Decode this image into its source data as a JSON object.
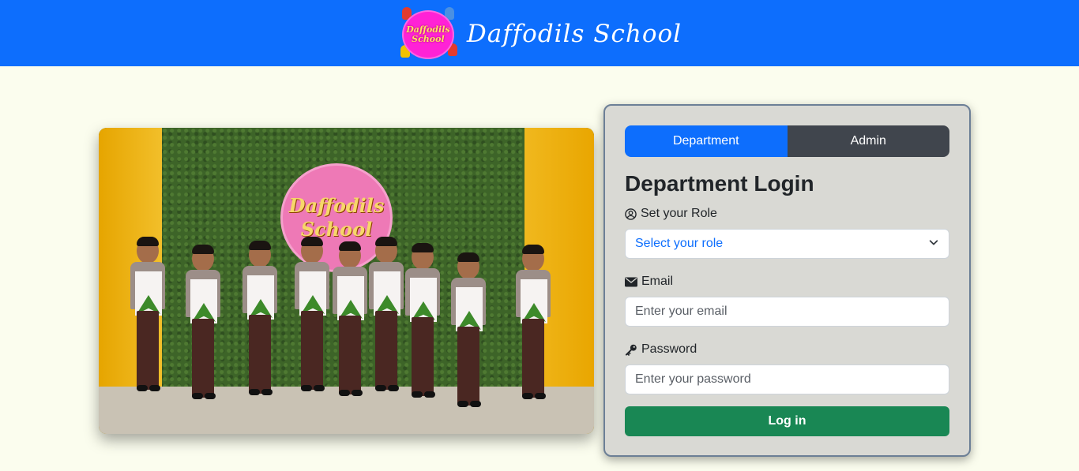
{
  "header": {
    "logo_text_line1": "Daffodils",
    "logo_text_line2": "School",
    "title": "Daffodils School",
    "background": "#0d6efd"
  },
  "photo": {
    "sign_line1": "Daffodils",
    "sign_line2": "School"
  },
  "login": {
    "tabs": [
      {
        "label": "Department",
        "active": true
      },
      {
        "label": "Admin",
        "active": false
      }
    ],
    "title": "Department Login",
    "role": {
      "label": "Set your Role",
      "icon": "user-circle-icon",
      "selected": "Select your role"
    },
    "email": {
      "label": "Email",
      "icon": "envelope-icon",
      "placeholder": "Enter your email"
    },
    "password": {
      "label": "Password",
      "icon": "key-icon",
      "placeholder": "Enter your password"
    },
    "submit_label": "Log in",
    "colors": {
      "active_tab": "#0d6efd",
      "inactive_tab": "#40454d",
      "submit": "#198754",
      "card": "#d9d9d4"
    }
  }
}
